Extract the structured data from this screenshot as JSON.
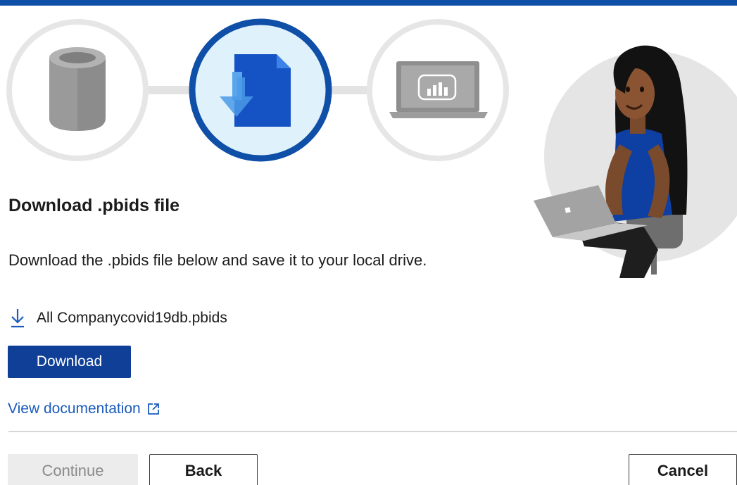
{
  "header": {
    "accent_color": "#0f4fa8"
  },
  "steps": [
    {
      "icon": "database-icon",
      "state": "done"
    },
    {
      "icon": "download-file-icon",
      "state": "active"
    },
    {
      "icon": "laptop-powerbi-icon",
      "state": "upcoming"
    }
  ],
  "main": {
    "title": "Download .pbids file",
    "description": "Download the .pbids file below and save it to your local drive.",
    "file_icon": "download-arrow-icon",
    "file_name": "All Companycovid19db.pbids",
    "download_label": "Download",
    "doc_link_label": "View documentation",
    "doc_link_icon": "external-link-icon"
  },
  "footer": {
    "continue_label": "Continue",
    "back_label": "Back",
    "cancel_label": "Cancel"
  },
  "illustration": {
    "icon": "woman-with-laptop-illustration"
  }
}
